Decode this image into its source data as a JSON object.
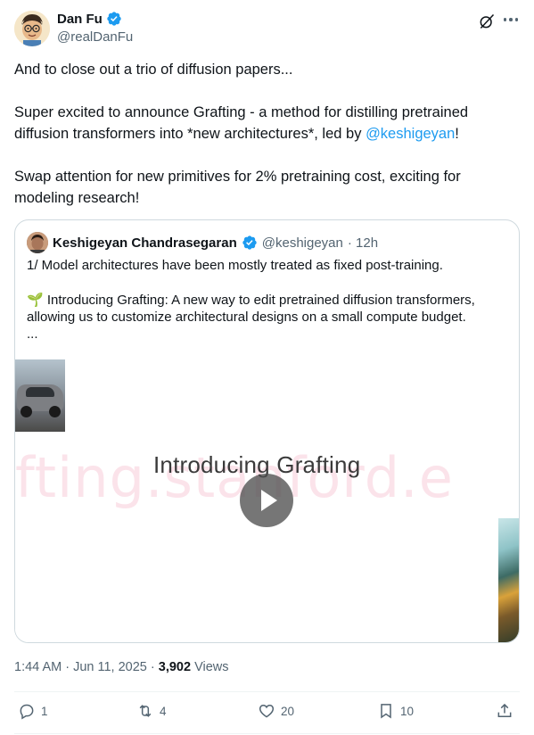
{
  "author": {
    "name": "Dan Fu",
    "handle": "@realDanFu",
    "verified": true
  },
  "tweet": {
    "line1": "And to close out a trio of diffusion papers...",
    "line2_pre": "Super excited to announce Grafting - a method for distilling pretrained diffusion transformers into *new architectures*, led by ",
    "line2_mention": "@keshigeyan",
    "line2_post": "!",
    "line3": "Swap attention for new primitives for 2% pretraining cost, exciting for modeling research!"
  },
  "quote": {
    "name": "Keshigeyan Chandrasegaran",
    "handle": "@keshigeyan",
    "time": "· 12h",
    "text1": "1/ Model architectures have been mostly treated as fixed post-training.",
    "text2_emoji": "🌱",
    "text2": "Introducing Grafting: A new way to edit pretrained diffusion transformers, allowing us to customize architectural designs on a small compute budget.",
    "text3": "...",
    "video": {
      "title": "Introducing Grafting",
      "watermark": "fting.stanford.e"
    }
  },
  "meta": {
    "time": "1:44 AM · Jun 11, 2025 · ",
    "views_count": "3,902",
    "views_label": " Views"
  },
  "actions": {
    "replies": "1",
    "reposts": "4",
    "likes": "20",
    "bookmarks": "10"
  },
  "colors": {
    "accent": "#1d9bf0",
    "secondary_text": "#536471",
    "border": "#cfd9de"
  }
}
